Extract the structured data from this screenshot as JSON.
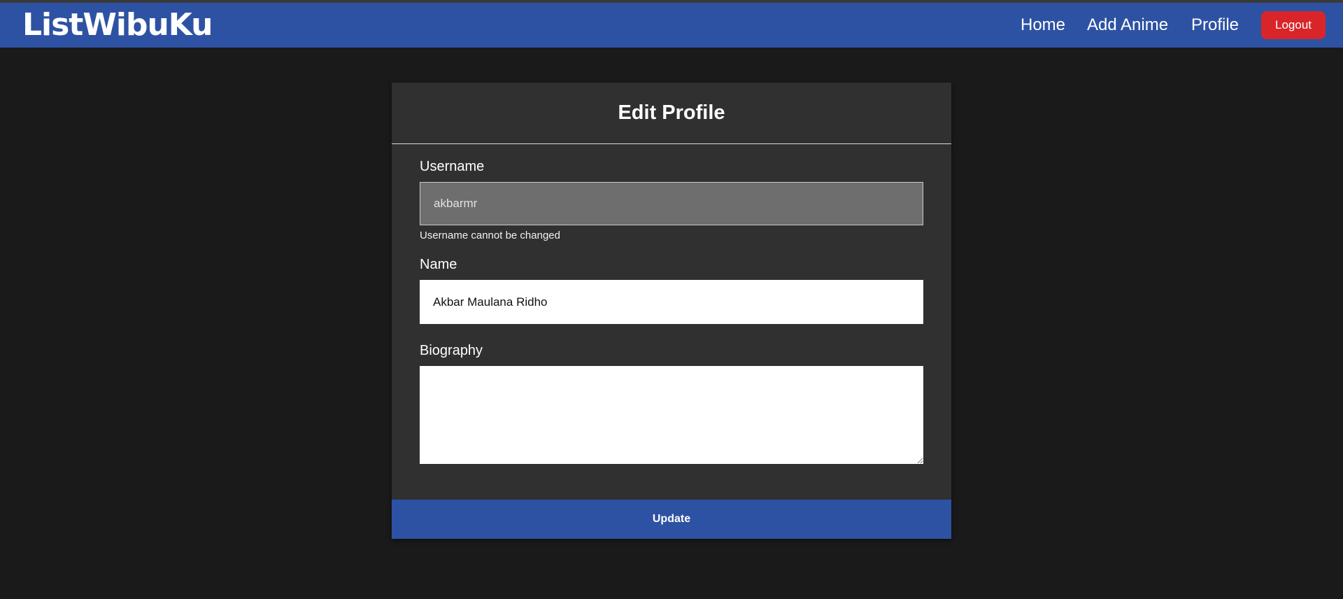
{
  "navbar": {
    "brand": "ListWibuKu",
    "links": {
      "home": "Home",
      "add_anime": "Add Anime",
      "profile": "Profile"
    },
    "logout_label": "Logout",
    "colors": {
      "navbar_bg": "#2e52a3",
      "logout_bg": "#d9252a"
    }
  },
  "form": {
    "title": "Edit Profile",
    "username": {
      "label": "Username",
      "value": "akbarmr",
      "help": "Username cannot be changed"
    },
    "name": {
      "label": "Name",
      "value": "Akbar Maulana Ridho"
    },
    "biography": {
      "label": "Biography",
      "value": ""
    },
    "submit_label": "Update"
  }
}
